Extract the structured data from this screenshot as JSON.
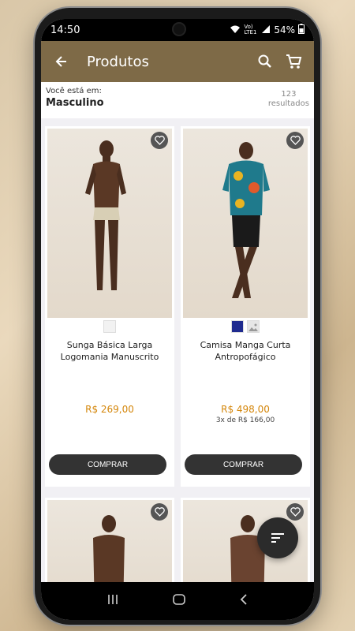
{
  "status": {
    "time": "14:50",
    "battery": "54%",
    "network": "Vo) LTE1"
  },
  "appbar": {
    "title": "Produtos"
  },
  "breadcrumb": {
    "label": "Você está em:",
    "value": "Masculino",
    "count": "123",
    "count_label": "resultados"
  },
  "products": [
    {
      "name": "Sunga Básica Larga Logomania Manuscrito",
      "price": "R$ 269,00",
      "installments": "",
      "buy_label": "COMPRAR",
      "swatches": [
        "#f2f2f2"
      ]
    },
    {
      "name": "Camisa Manga Curta Antropofágico",
      "price": "R$ 498,00",
      "installments": "3x de R$ 166,00",
      "buy_label": "COMPRAR",
      "swatches": [
        "#1f2b8f",
        "#e6e6e6"
      ]
    }
  ],
  "colors": {
    "appbar": "#7e6a47",
    "price": "#d4860a",
    "button": "#333333"
  },
  "icons": [
    "back-arrow-icon",
    "search-icon",
    "cart-icon",
    "heart-icon",
    "filter-sort-icon"
  ]
}
